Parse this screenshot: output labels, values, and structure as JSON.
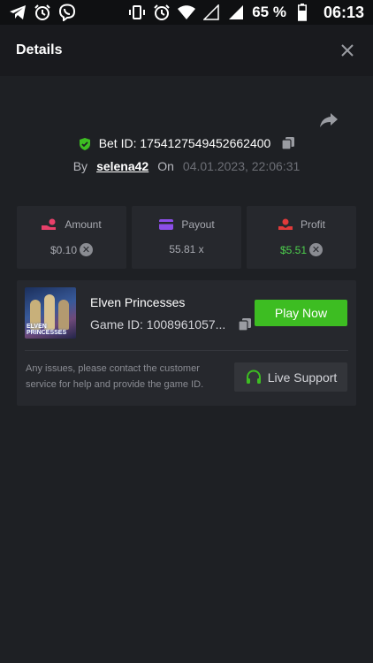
{
  "status_bar": {
    "left_icons": [
      "telegram-icon",
      "alarm-icon",
      "viber-icon"
    ],
    "right_icons": [
      "vibrate-icon",
      "alarm-icon",
      "wifi-icon",
      "signal-empty-icon",
      "signal-icon"
    ],
    "battery": "65 %",
    "time": "06:13"
  },
  "header": {
    "title": "Details",
    "close_icon": "close-icon"
  },
  "bet": {
    "id_label": "Bet ID: 1754127549452662400",
    "by_label": "By",
    "username": "selena42",
    "on_label": "On",
    "date": "04.01.2023, 22:06:31"
  },
  "stats": [
    {
      "label": "Amount",
      "value": "$0.10",
      "icon": "amount-icon",
      "color": "#e8406a"
    },
    {
      "label": "Payout",
      "value": "55.81 x",
      "icon": "card-icon",
      "color": "#8c4ee8"
    },
    {
      "label": "Profit",
      "value": "$5.51",
      "icon": "profit-icon",
      "color": "#e03a3a"
    }
  ],
  "game": {
    "name": "Elven Princesses",
    "thumb_title": "ELVEN PRINCESSES",
    "game_id": "Game ID: 1008961057...",
    "play_label": "Play Now",
    "support_text": "Any issues, please contact the customer service for help and provide the game ID.",
    "support_label": "Live Support"
  },
  "colors": {
    "accent_green": "#3dbd22",
    "profit_green": "#4dd04d",
    "background": "#1e2024",
    "card": "#26282d"
  }
}
